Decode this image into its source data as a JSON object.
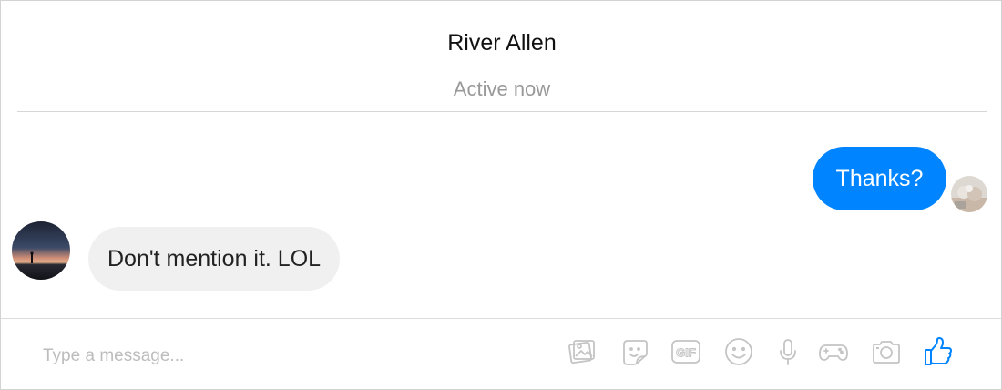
{
  "header": {
    "contact_name": "River Allen",
    "status": "Active now"
  },
  "messages": [
    {
      "direction": "outgoing",
      "text": "Thanks?",
      "avatar": "sender-avatar"
    },
    {
      "direction": "incoming",
      "text": "Don't mention it. LOL",
      "avatar": "contact-avatar"
    }
  ],
  "composer": {
    "placeholder": "Type a message...",
    "value": "",
    "tools": [
      {
        "icon": "photo-icon"
      },
      {
        "icon": "sticker-icon"
      },
      {
        "icon": "gif-icon",
        "label": "GIF"
      },
      {
        "icon": "emoji-icon"
      },
      {
        "icon": "microphone-icon"
      },
      {
        "icon": "game-controller-icon"
      },
      {
        "icon": "camera-icon"
      },
      {
        "icon": "thumbs-up-icon"
      }
    ]
  },
  "colors": {
    "accent": "#0084ff",
    "incoming_bubble": "#f1f0f0",
    "icon_gray": "#c4c4c4"
  }
}
